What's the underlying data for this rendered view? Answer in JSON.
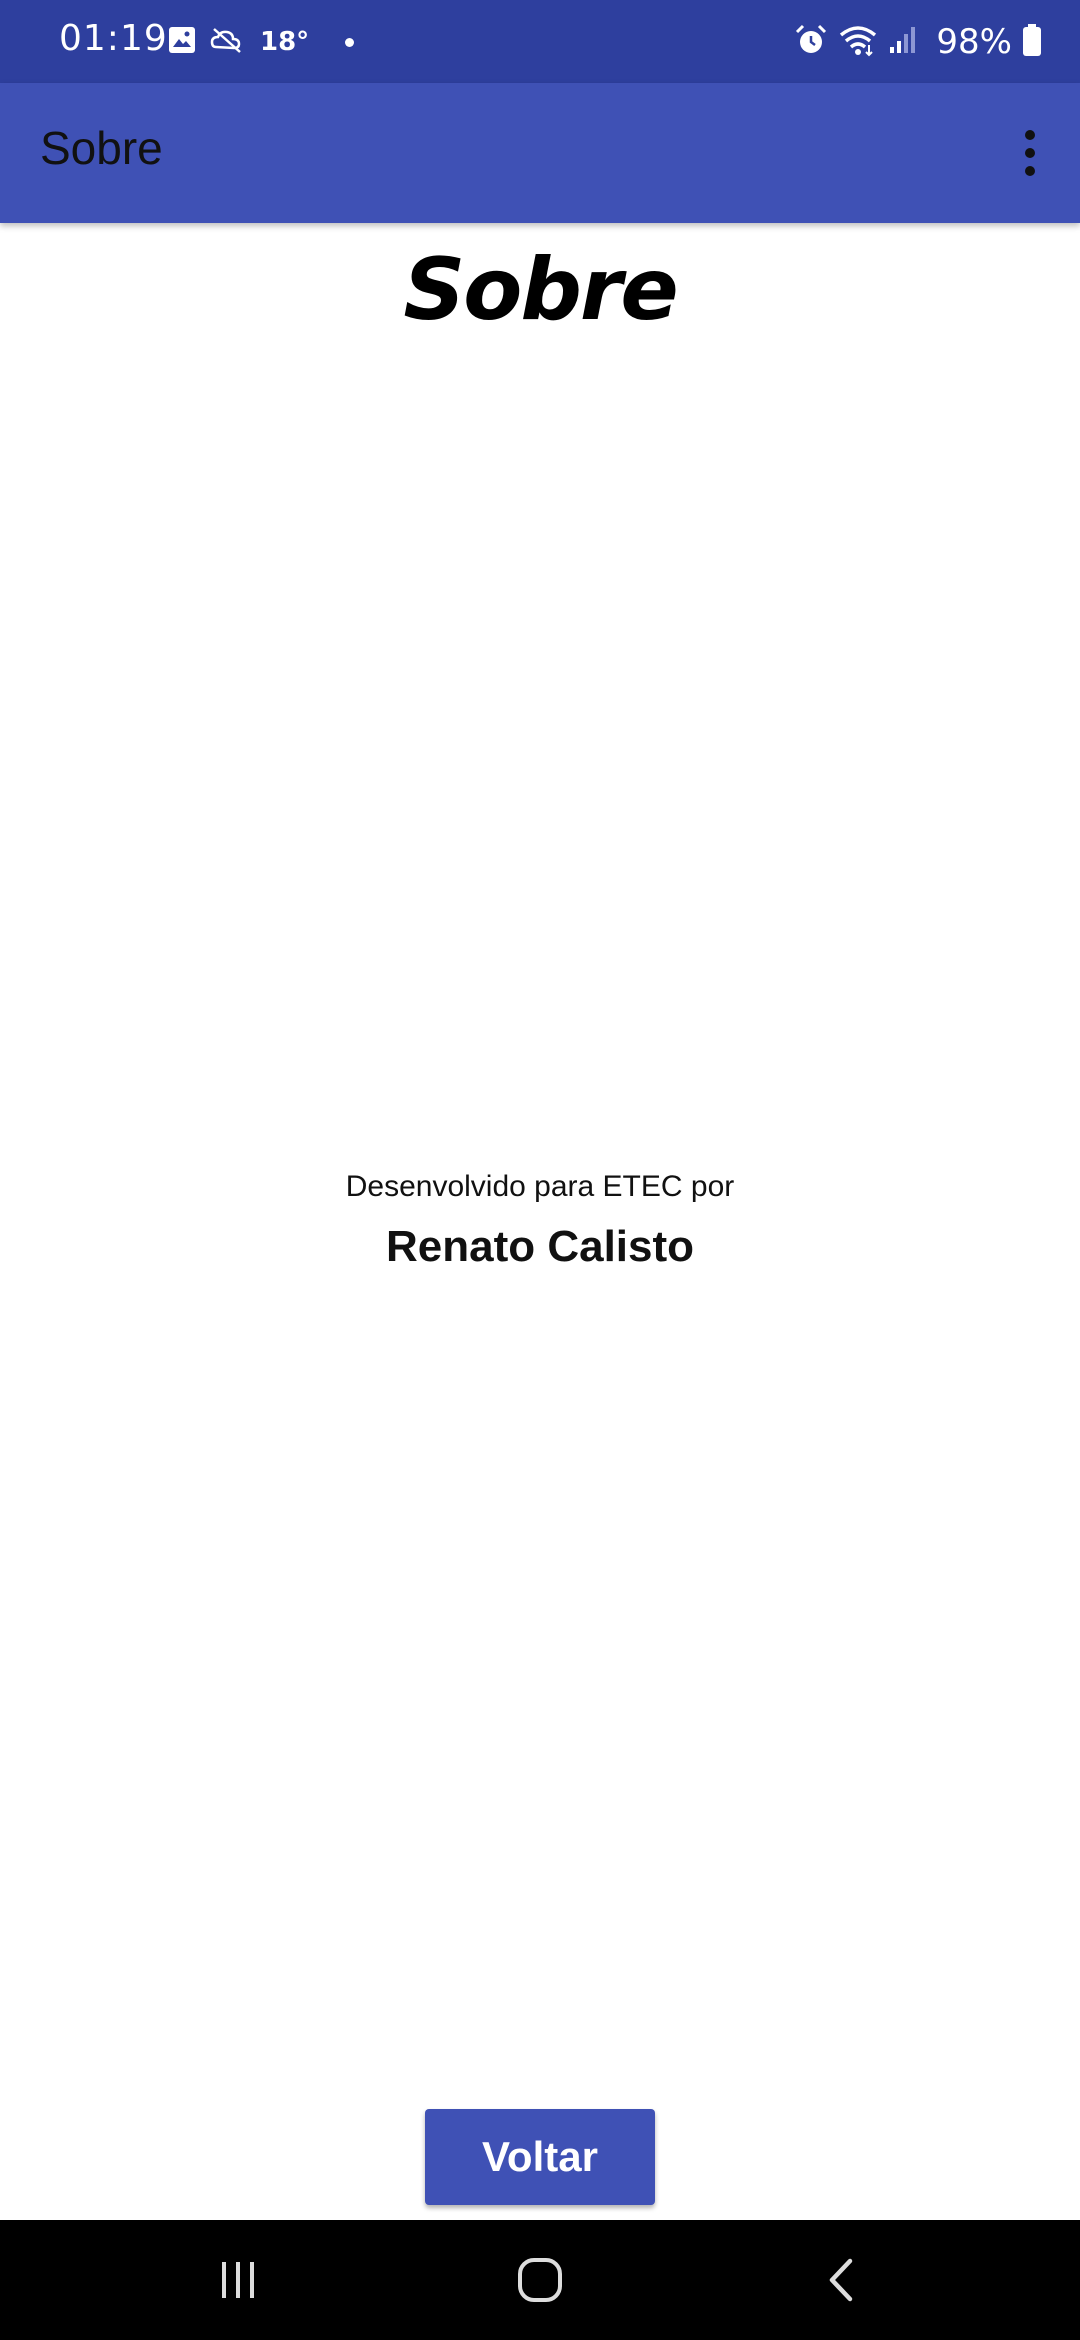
{
  "status_bar": {
    "time": "01:19",
    "temperature": "18°",
    "battery": "98%",
    "icons": [
      "image-icon",
      "weather-icon",
      "alarm-icon",
      "wifi-icon",
      "signal-icon",
      "battery-icon"
    ]
  },
  "app_bar": {
    "title": "Sobre",
    "menu_icon": "more-vert-icon"
  },
  "main": {
    "heading": "Sobre",
    "caption": "Desenvolvido para ETEC por",
    "developer": "Renato Calisto",
    "back_label": "Voltar"
  },
  "nav_bar": {
    "icons": [
      "recent-apps-icon",
      "home-icon",
      "back-icon"
    ]
  },
  "colors": {
    "status_bar": "#2e3f9e",
    "app_bar": "#3f51b5",
    "accent": "#3f51b5",
    "background": "#ffffff",
    "nav_bar": "#000000"
  }
}
